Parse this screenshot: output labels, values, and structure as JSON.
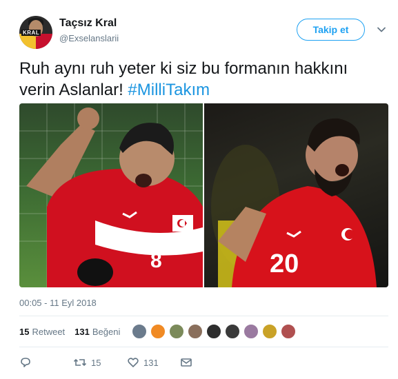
{
  "user": {
    "name": "Taçsız Kral",
    "handle": "@Exselanslarii",
    "avatar_badge": "KRAL"
  },
  "follow_button": {
    "label": "Takip et"
  },
  "tweet": {
    "text_main": "Ruh aynı ruh yeter ki siz bu formanın hakkını verin Aslanlar!",
    "hashtag": "#MilliTakım"
  },
  "media": {
    "left_jersey_number": "8",
    "right_jersey_number": "20"
  },
  "timestamp": "00:05 - 11 Eyl 2018",
  "stats": {
    "retweet_count": "15",
    "retweet_label": "Retweet",
    "like_count": "131",
    "like_label": "Beğeni"
  },
  "likers": [
    "#6b7b8c",
    "#f08a24",
    "#7b8a5a",
    "#8a6f5c",
    "#2e2e2e",
    "#3a3a3a",
    "#9a7aa0",
    "#c9a227",
    "#b05050"
  ],
  "actions": {
    "reply_icon": "reply-icon",
    "retweet_count": "15",
    "like_count": "131",
    "dm_icon": "envelope-icon"
  },
  "colors": {
    "accent": "#1da1f2",
    "hashtag": "#1b95e0",
    "muted": "#657786"
  }
}
